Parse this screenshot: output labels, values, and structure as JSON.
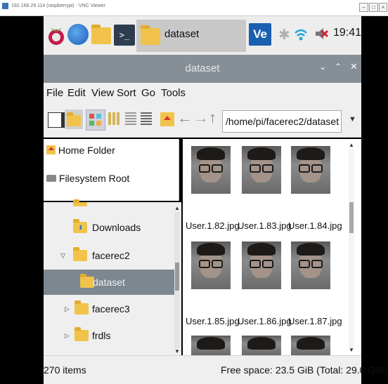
{
  "vnc": {
    "title": "192.168.29.114 (raspberrypi) - VNC Viewer"
  },
  "panel": {
    "task_label": "dataset",
    "clock": "19:41"
  },
  "window": {
    "title": "dataset"
  },
  "menu": [
    "File",
    "Edit",
    "View",
    "Sort",
    "Go",
    "Tools"
  ],
  "toolbar": {
    "path": "/home/pi/facerec2/dataset"
  },
  "places": [
    {
      "label": "Home Folder",
      "icon": "home-icon"
    },
    {
      "label": "Filesystem Root",
      "icon": "drive-icon"
    }
  ],
  "tree": [
    {
      "label": "Downloads",
      "icon": "downloads-folder-icon",
      "expander": "none",
      "selected": false
    },
    {
      "label": "facerec2",
      "icon": "folder-icon",
      "expander": "expanded",
      "selected": false
    },
    {
      "label": "dataset",
      "icon": "folder-icon",
      "expander": "none",
      "selected": true
    },
    {
      "label": "facerec3",
      "icon": "folder-icon",
      "expander": "collapsed",
      "selected": false
    },
    {
      "label": "frdls",
      "icon": "folder-icon",
      "expander": "collapsed",
      "selected": false
    }
  ],
  "files": [
    {
      "name": "User.1.82.jpg"
    },
    {
      "name": "User.1.83.jpg"
    },
    {
      "name": "User.1.84.jpg"
    },
    {
      "name": "User.1.85.jpg"
    },
    {
      "name": "User.1.86.jpg"
    },
    {
      "name": "User.1.87.jpg"
    }
  ],
  "status": {
    "count": "270 items",
    "free": "Free space: 23.5 GiB (Total: 29.0 GiB)"
  },
  "colors": {
    "titlebar": "#868e96",
    "selection": "#7d8790",
    "folder": "#f1c34a",
    "accent_blue": "#2b72c8"
  }
}
